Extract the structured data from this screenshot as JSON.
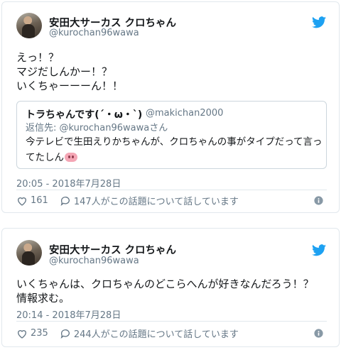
{
  "tweets": [
    {
      "user": {
        "display_name": "安田大サーカス クロちゃん",
        "handle": "@kurochan96wawa"
      },
      "body": [
        "えっ！？",
        "マジだしんかー！？",
        "いくちゃーーーん！！"
      ],
      "quote": {
        "name": "トラちゃんです(´・ω・`)",
        "handle": "@makichan2000",
        "reply_to": "返信先: @kurochan96wawaさん",
        "text_line1": "今テレビで生田えりかちゃんが、クロちゃんの事がタイプだって言っ",
        "text_line2": "てたしん"
      },
      "timestamp": "20:05 - 2018年7月28日",
      "likes": "161",
      "talk": "147人がこの話題について話しています"
    },
    {
      "user": {
        "display_name": "安田大サーカス クロちゃん",
        "handle": "@kurochan96wawa"
      },
      "body": [
        "いくちゃんは、クロちゃんのどこらへんが好きなんだろう！？",
        "情報求む。"
      ],
      "timestamp": "20:14 - 2018年7月28日",
      "likes": "235",
      "talk": "244人がこの話題について話しています"
    }
  ],
  "colors": {
    "brand": "#1da1f2",
    "text": "#14171a",
    "muted": "#657786",
    "border": "#e1e8ed"
  },
  "icons": [
    "twitter-bird-icon",
    "heart-icon",
    "comment-icon",
    "info-icon",
    "pig-nose-emoji"
  ]
}
